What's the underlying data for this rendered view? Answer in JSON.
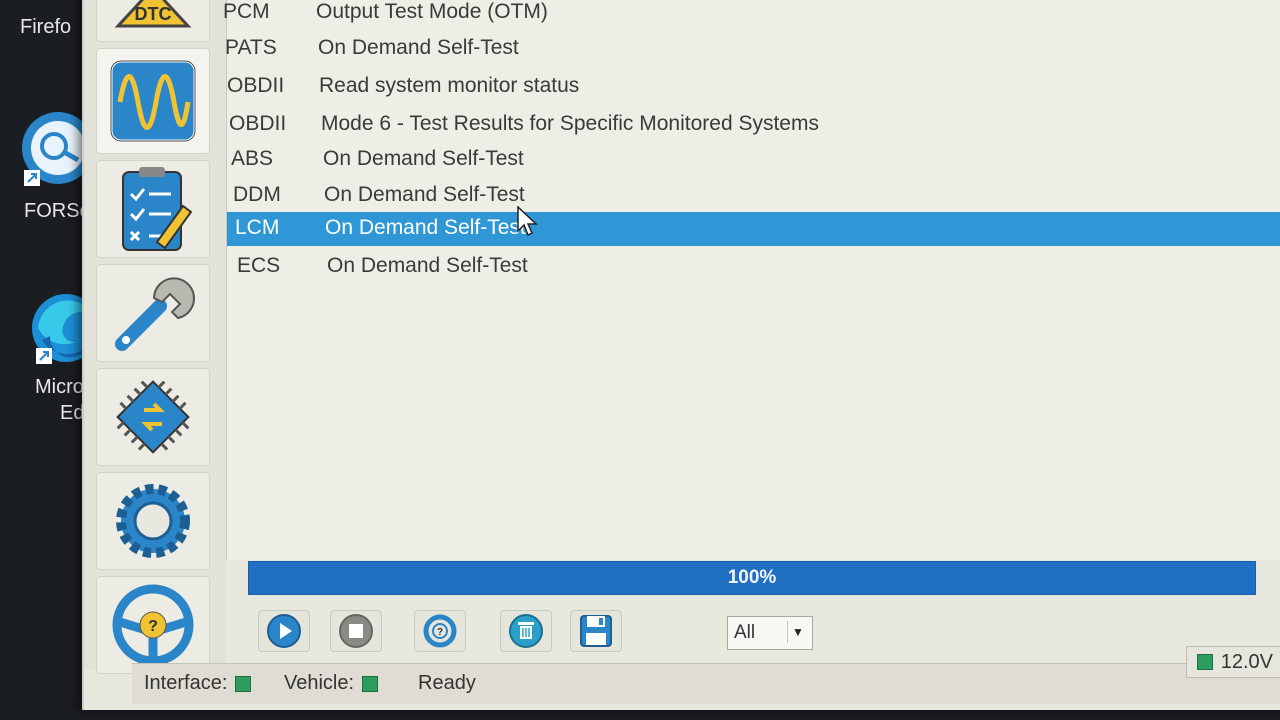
{
  "desktop": {
    "icons": [
      {
        "label": "Firefo",
        "icon": "firefox-icon"
      },
      {
        "label": "FORSca",
        "icon": "forscan-icon"
      },
      {
        "label_line1": "Microso",
        "label_line2": "Edge",
        "icon": "edge-icon"
      }
    ]
  },
  "sidebar": {
    "items": [
      {
        "name": "dtc",
        "icon": "dtc-icon",
        "label": "DTC"
      },
      {
        "name": "oscilloscope",
        "icon": "oscilloscope-icon"
      },
      {
        "name": "tests",
        "icon": "checklist-icon"
      },
      {
        "name": "service",
        "icon": "wrench-icon"
      },
      {
        "name": "programming",
        "icon": "chip-icon"
      },
      {
        "name": "configuration",
        "icon": "gear-icon"
      },
      {
        "name": "help",
        "icon": "steering-wheel-help-icon"
      }
    ]
  },
  "tests": {
    "rows": [
      {
        "code": "PCM",
        "description": "Output Test Mode (OTM)"
      },
      {
        "code": "PATS",
        "description": "On Demand Self-Test"
      },
      {
        "code": "OBDII",
        "description": "Read system monitor status"
      },
      {
        "code": "OBDII",
        "description": "Mode 6 - Test Results for Specific Monitored Systems"
      },
      {
        "code": "ABS",
        "description": "On Demand Self-Test"
      },
      {
        "code": "DDM",
        "description": "On Demand Self-Test"
      },
      {
        "code": "LCM",
        "description": "On Demand Self-Test",
        "selected": true
      },
      {
        "code": "ECS",
        "description": "On Demand Self-Test"
      }
    ]
  },
  "progress": {
    "value": 1.0,
    "label": "100%"
  },
  "toolbar": {
    "buttons": [
      {
        "name": "run",
        "icon": "play-icon"
      },
      {
        "name": "stop",
        "icon": "stop-icon"
      },
      {
        "name": "help",
        "icon": "help-icon"
      },
      {
        "name": "clear",
        "icon": "trash-icon"
      },
      {
        "name": "save",
        "icon": "save-icon"
      }
    ],
    "filter": {
      "value": "All"
    }
  },
  "statusbar": {
    "interface_label": "Interface:",
    "vehicle_label": "Vehicle:",
    "status": "Ready",
    "voltage": "12.0V"
  },
  "colors": {
    "selection": "#2f97d6",
    "progress": "#1f6fc2",
    "led_green": "#2e9c5e",
    "icon_blue": "#2a86c8"
  }
}
